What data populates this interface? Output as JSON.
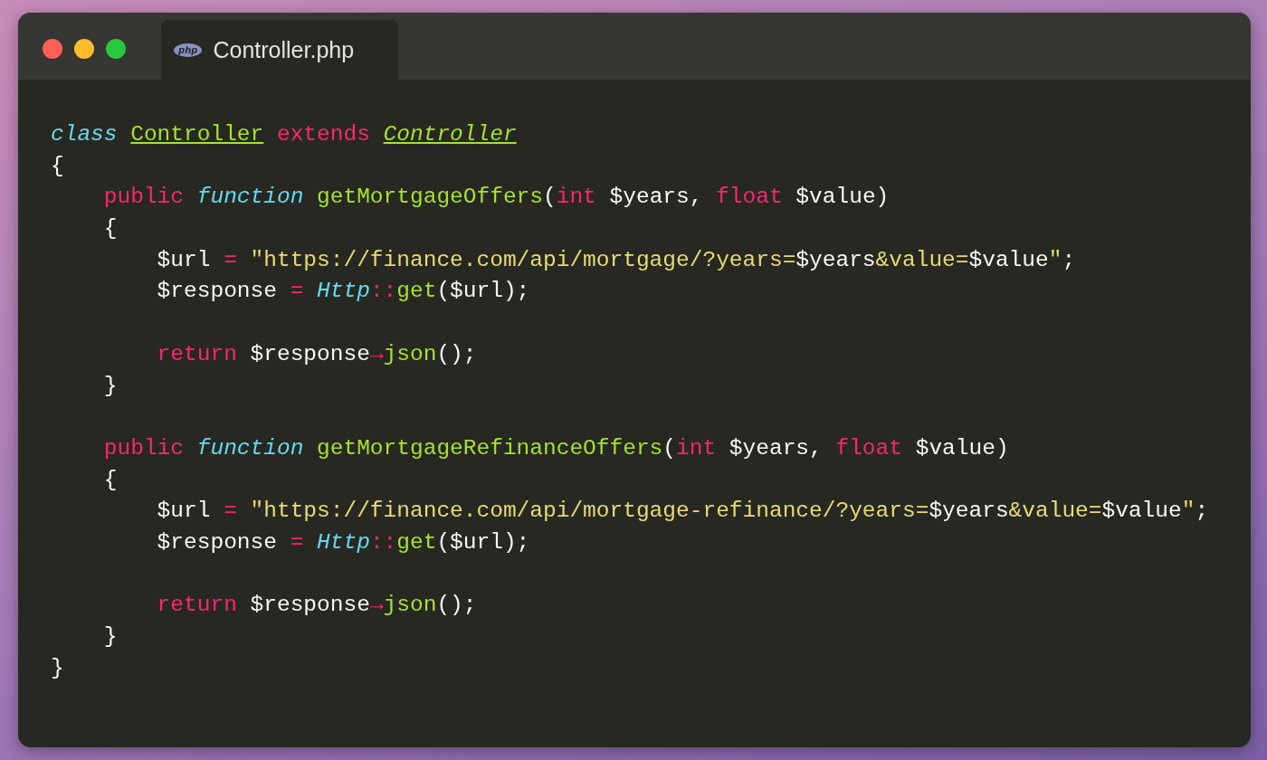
{
  "window": {
    "controls": [
      {
        "color": "#ff5f57"
      },
      {
        "color": "#febc2e"
      },
      {
        "color": "#28c840"
      }
    ]
  },
  "tab": {
    "icon_text": "php",
    "label": "Controller.php"
  },
  "code": [
    {
      "kind": "code",
      "tokens": [
        {
          "kind": "storage",
          "text": "class "
        },
        {
          "kind": "cls",
          "text": "Controller"
        },
        {
          "kind": "kw",
          "text": " extends "
        },
        {
          "kind": "clsi",
          "text": "Controller"
        }
      ]
    },
    {
      "kind": "code",
      "tokens": [
        {
          "kind": "plain",
          "text": "{"
        }
      ]
    },
    {
      "kind": "code",
      "tokens": [
        {
          "kind": "kw",
          "text": "    public "
        },
        {
          "kind": "storage",
          "text": "function "
        },
        {
          "kind": "fn",
          "text": "getMortgageOffers"
        },
        {
          "kind": "plain",
          "text": "("
        },
        {
          "kind": "kw",
          "text": "int"
        },
        {
          "kind": "plain",
          "text": " $years, "
        },
        {
          "kind": "kw",
          "text": "float"
        },
        {
          "kind": "plain",
          "text": " $value)"
        }
      ]
    },
    {
      "kind": "code",
      "tokens": [
        {
          "kind": "plain",
          "text": "    {"
        }
      ]
    },
    {
      "kind": "code",
      "tokens": [
        {
          "kind": "plain",
          "text": "        $url "
        },
        {
          "kind": "op",
          "text": "= "
        },
        {
          "kind": "str",
          "text": "\"https://finance.com/api/mortgage/?years="
        },
        {
          "kind": "plain",
          "text": "$years"
        },
        {
          "kind": "str",
          "text": "&value="
        },
        {
          "kind": "plain",
          "text": "$value"
        },
        {
          "kind": "str",
          "text": "\""
        },
        {
          "kind": "plain",
          "text": ";"
        }
      ]
    },
    {
      "kind": "code",
      "tokens": [
        {
          "kind": "plain",
          "text": "        $response "
        },
        {
          "kind": "op",
          "text": "= "
        },
        {
          "kind": "type",
          "text": "Http"
        },
        {
          "kind": "op",
          "text": "::"
        },
        {
          "kind": "fn",
          "text": "get"
        },
        {
          "kind": "plain",
          "text": "($url);"
        }
      ]
    },
    {
      "kind": "blank"
    },
    {
      "kind": "code",
      "tokens": [
        {
          "kind": "kw",
          "text": "        return"
        },
        {
          "kind": "plain",
          "text": " $response"
        },
        {
          "kind": "op",
          "text": "→"
        },
        {
          "kind": "fn",
          "text": "json"
        },
        {
          "kind": "plain",
          "text": "();"
        }
      ]
    },
    {
      "kind": "code",
      "tokens": [
        {
          "kind": "plain",
          "text": "    }"
        }
      ]
    },
    {
      "kind": "blank"
    },
    {
      "kind": "code",
      "tokens": [
        {
          "kind": "kw",
          "text": "    public "
        },
        {
          "kind": "storage",
          "text": "function "
        },
        {
          "kind": "fn",
          "text": "getMortgageRefinanceOffers"
        },
        {
          "kind": "plain",
          "text": "("
        },
        {
          "kind": "kw",
          "text": "int"
        },
        {
          "kind": "plain",
          "text": " $years, "
        },
        {
          "kind": "kw",
          "text": "float"
        },
        {
          "kind": "plain",
          "text": " $value)"
        }
      ]
    },
    {
      "kind": "code",
      "tokens": [
        {
          "kind": "plain",
          "text": "    {"
        }
      ]
    },
    {
      "kind": "code",
      "tokens": [
        {
          "kind": "plain",
          "text": "        $url "
        },
        {
          "kind": "op",
          "text": "= "
        },
        {
          "kind": "str",
          "text": "\"https://finance.com/api/mortgage-refinance/?years="
        },
        {
          "kind": "plain",
          "text": "$years"
        },
        {
          "kind": "str",
          "text": "&value="
        },
        {
          "kind": "plain",
          "text": "$value"
        },
        {
          "kind": "str",
          "text": "\""
        },
        {
          "kind": "plain",
          "text": ";"
        }
      ]
    },
    {
      "kind": "code",
      "tokens": [
        {
          "kind": "plain",
          "text": "        $response "
        },
        {
          "kind": "op",
          "text": "= "
        },
        {
          "kind": "type",
          "text": "Http"
        },
        {
          "kind": "op",
          "text": "::"
        },
        {
          "kind": "fn",
          "text": "get"
        },
        {
          "kind": "plain",
          "text": "($url);"
        }
      ]
    },
    {
      "kind": "blank"
    },
    {
      "kind": "code",
      "tokens": [
        {
          "kind": "kw",
          "text": "        return"
        },
        {
          "kind": "plain",
          "text": " $response"
        },
        {
          "kind": "op",
          "text": "→"
        },
        {
          "kind": "fn",
          "text": "json"
        },
        {
          "kind": "plain",
          "text": "();"
        }
      ]
    },
    {
      "kind": "code",
      "tokens": [
        {
          "kind": "plain",
          "text": "    }"
        }
      ]
    },
    {
      "kind": "code",
      "tokens": [
        {
          "kind": "plain",
          "text": "}"
        }
      ]
    }
  ]
}
